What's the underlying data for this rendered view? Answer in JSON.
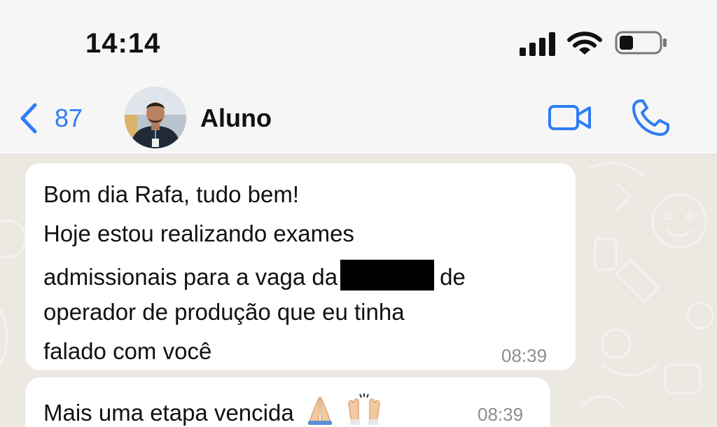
{
  "status_bar": {
    "time": "14:14",
    "icons": [
      "cellular-signal-icon",
      "wifi-icon",
      "battery-icon"
    ]
  },
  "header": {
    "back_count": "87",
    "contact_name": "Aluno",
    "icons": [
      "chevron-left-icon",
      "video-camera-icon",
      "phone-icon"
    ],
    "accent_color": "#2f7cf6"
  },
  "messages": [
    {
      "lines": [
        "Bom dia Rafa, tudo bem!",
        "Hoje estou realizando exames",
        "admissionais para a vaga da",
        "de",
        "operador de produção que eu tinha",
        "falado com você"
      ],
      "redacted": true,
      "time": "08:39"
    },
    {
      "text": "Mais uma etapa vencida",
      "emojis": [
        "folded-hands-emoji",
        "raising-hands-emoji"
      ],
      "time": "08:39"
    }
  ]
}
